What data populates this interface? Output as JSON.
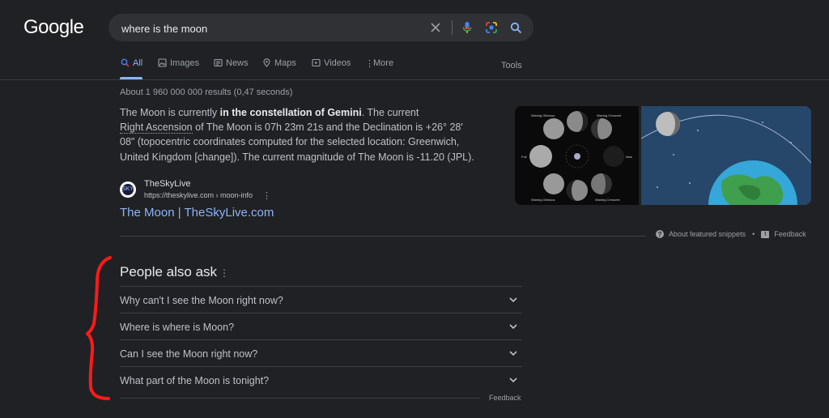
{
  "logo": "Google",
  "search": {
    "query": "where is the moon"
  },
  "icons": {
    "clear": "close-icon",
    "mic": "mic-icon",
    "lens": "camera-lens-icon",
    "search": "search-icon"
  },
  "tabs": [
    {
      "label": "All",
      "icon": "search-icon",
      "active": true
    },
    {
      "label": "Images",
      "icon": "image-icon"
    },
    {
      "label": "News",
      "icon": "news-icon"
    },
    {
      "label": "Maps",
      "icon": "map-pin-icon"
    },
    {
      "label": "Videos",
      "icon": "video-icon"
    },
    {
      "label": "More",
      "icon": "more-vertical-icon"
    }
  ],
  "tools": "Tools",
  "result_stats": "About 1 960 000 000 results (0,47 seconds)",
  "snippet": {
    "part1": "The Moon is currently ",
    "bold": "in the constellation of Gemini",
    "part2": ". The current",
    "dotted": "Right Ascension",
    "part3": " of The Moon is 07h 23m 21s and the Declination is +26° 28' 08\" (topocentric coordinates computed for the selected location: Greenwich, United Kingdom [change]). The current magnitude of The Moon is -11.20 (JPL)."
  },
  "source": {
    "name": "TheSkyLive",
    "url": "https://theskylive.com › moon-info",
    "favicon_text": "SKY",
    "title": "The Moon | TheSkyLive.com"
  },
  "images": {
    "phases_labels": {
      "top_left": "Waxing Gibbous",
      "top_right": "Waxing Crescent",
      "left": "Full",
      "right": "New",
      "bottom_left": "Waning Gibbous",
      "bottom_right": "Waning Crescent"
    }
  },
  "snippet_footer": {
    "about": "About featured snippets",
    "dot": "•",
    "feedback": "Feedback"
  },
  "people_also_ask": {
    "title": "People also ask",
    "questions": [
      "Why can't I see the Moon right now?",
      "Where is where is Moon?",
      "Can I see the Moon right now?",
      "What part of the Moon is tonight?"
    ],
    "feedback": "Feedback"
  },
  "colors": {
    "background": "#202124",
    "link": "#8ab4f8",
    "annotation": "#ff1a1a"
  }
}
